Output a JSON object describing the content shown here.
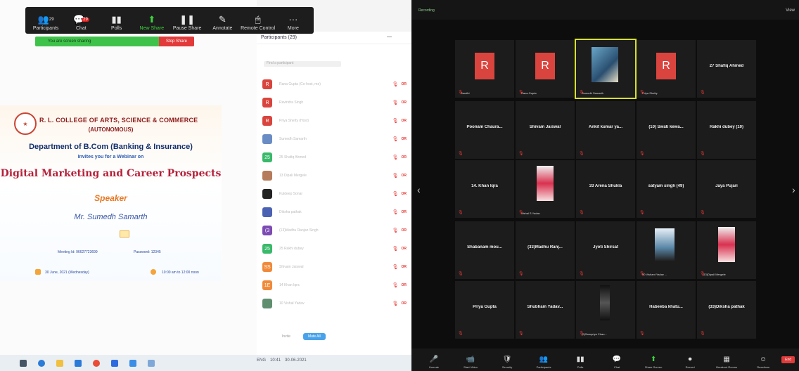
{
  "toolbar": {
    "items": [
      {
        "label": "Participants",
        "icon": "participants-icon",
        "glyph": "👥",
        "count": "29"
      },
      {
        "label": "Chat",
        "icon": "chat-icon",
        "glyph": "💬",
        "badge": "29"
      },
      {
        "label": "Polls",
        "icon": "polls-icon",
        "glyph": "▮▮"
      },
      {
        "label": "New Share",
        "icon": "share-icon",
        "glyph": "⬆"
      },
      {
        "label": "Pause Share",
        "icon": "pause-icon",
        "glyph": "❚❚"
      },
      {
        "label": "Annotate",
        "icon": "pen-icon",
        "glyph": "✎"
      },
      {
        "label": "Remote Control",
        "icon": "mouse-icon",
        "glyph": "🖱"
      },
      {
        "label": "More",
        "icon": "more-icon",
        "glyph": "···"
      }
    ]
  },
  "sharing_bar": {
    "text": "You are screen sharing",
    "stop": "Stop Share"
  },
  "flyer": {
    "college": "R. L. COLLEGE OF ARTS, SCIENCE & COMMERCE",
    "autonomous": "(AUTONOMOUS)",
    "department": "Department of B.Com (Banking & Insurance)",
    "invite": "Invites you for a Webinar on",
    "topic": "Digital Marketing and Career Prospects",
    "speaker_heading": "Speaker",
    "speaker_name": "Mr. Sumedh Samarth",
    "meeting_id": "Meeting Id: 96627723699",
    "passcode": "Password: 12345",
    "date": "30 June, 2021 (Wednesday)",
    "time": "10:00 am to 12:00 noon"
  },
  "participants_panel": {
    "header": "Participants (29)",
    "search_placeholder": "Find a participant",
    "invite": "Invite",
    "mute_all": "Mute All",
    "rows": [
      {
        "initial": "R",
        "color": "#d9453e",
        "name": "Rana Gupta (Co-host, me)"
      },
      {
        "initial": "R",
        "color": "#d9453e",
        "name": "Ravindra Singh"
      },
      {
        "initial": "R",
        "color": "#d9453e",
        "name": "Priya Shetty (Host)"
      },
      {
        "initial": "",
        "color": "#6a8cc4",
        "name": "Sumedh Samarth"
      },
      {
        "initial": "25",
        "color": "#39b96a",
        "name": "25 Shafiq Ahmed"
      },
      {
        "initial": "",
        "color": "#b57b5a",
        "name": "13 Dipali Mergele"
      },
      {
        "initial": "",
        "color": "#222",
        "name": "Kuldeep Sonar"
      },
      {
        "initial": "",
        "color": "#4b62b3",
        "name": "Diksha pathak"
      },
      {
        "initial": "(3",
        "color": "#7c4bb3",
        "name": "(13)Madhu Ranjan Singh"
      },
      {
        "initial": "25",
        "color": "#39b96a",
        "name": "25 Rakhi dubey"
      },
      {
        "initial": "SS",
        "color": "#f08a3a",
        "name": "Shivam Jaiswal"
      },
      {
        "initial": "1E",
        "color": "#f08a3a",
        "name": "14 Khan Iqra"
      },
      {
        "initial": "",
        "color": "#5f8f6f",
        "name": "10 Vishal Yadav"
      }
    ]
  },
  "gallery": {
    "recording": "Recording",
    "view": "View",
    "tiles": [
      {
        "name": "",
        "caption": "Sandhi",
        "type": "r",
        "initial": "R"
      },
      {
        "name": "",
        "caption": "Rana Gupta",
        "type": "r",
        "initial": "R"
      },
      {
        "name": "",
        "caption": "Sumedh Samarth",
        "type": "photo",
        "active": true
      },
      {
        "name": "",
        "caption": "Priya Shetty",
        "type": "r",
        "initial": "R"
      },
      {
        "name": "27 Shafiq Ahmed",
        "caption": "",
        "type": "name"
      },
      {
        "name": "Poonam Chaura...",
        "caption": "",
        "type": "name"
      },
      {
        "name": "Shivam Jaiswal",
        "caption": "",
        "type": "name"
      },
      {
        "name": "Ankit kumar ya...",
        "caption": "",
        "type": "name"
      },
      {
        "name": "(10) Swati kewa...",
        "caption": "",
        "type": "name"
      },
      {
        "name": "Rakhi dubey (10)",
        "caption": "",
        "type": "name"
      },
      {
        "name": "14. Khan Iqra",
        "caption": "",
        "type": "name"
      },
      {
        "name": "",
        "caption": "Vishal S Yadav",
        "type": "photo2"
      },
      {
        "name": "33 Arena Shukla",
        "caption": "",
        "type": "name"
      },
      {
        "name": "satyam singh (49)",
        "caption": "",
        "type": "name"
      },
      {
        "name": "Jaya Pujari",
        "caption": "",
        "type": "name"
      },
      {
        "name": "Shabanam mou...",
        "caption": "",
        "type": "name"
      },
      {
        "name": "(33)Madhu Ranj...",
        "caption": "",
        "type": "name"
      },
      {
        "name": "Jyoti Shirsat",
        "caption": "",
        "type": "name"
      },
      {
        "name": "",
        "caption": "50 Vishant Yadav ...",
        "type": "photo3"
      },
      {
        "name": "",
        "caption": "(13)Dipali Mergele",
        "type": "photo2"
      },
      {
        "name": "Priya Gupta",
        "caption": "",
        "type": "name"
      },
      {
        "name": "Shubham Yadav...",
        "caption": "",
        "type": "name"
      },
      {
        "name": "",
        "caption": "(9)Sampriya Chau...",
        "type": "photo4"
      },
      {
        "name": "Habeeba khatu...",
        "caption": "",
        "type": "name"
      },
      {
        "name": "(33)Diksha pathak",
        "caption": "",
        "type": "name"
      }
    ],
    "controls": [
      {
        "label": "Unmute",
        "glyph": "🎤"
      },
      {
        "label": "Start Video",
        "glyph": "📹"
      },
      {
        "label": "Security",
        "glyph": "🛡"
      },
      {
        "label": "Participants",
        "glyph": "👥"
      },
      {
        "label": "Polls",
        "glyph": "▮▮"
      },
      {
        "label": "Chat",
        "glyph": "💬"
      },
      {
        "label": "Share Screen",
        "glyph": "⬆",
        "green": true
      },
      {
        "label": "Record",
        "glyph": "⏺"
      },
      {
        "label": "Breakout Rooms",
        "glyph": "▦"
      },
      {
        "label": "Reactions",
        "glyph": "☺"
      }
    ],
    "end": "End"
  },
  "taskbar": {
    "time": "10:41",
    "date": "30-06-2021",
    "lang": "ENG"
  }
}
